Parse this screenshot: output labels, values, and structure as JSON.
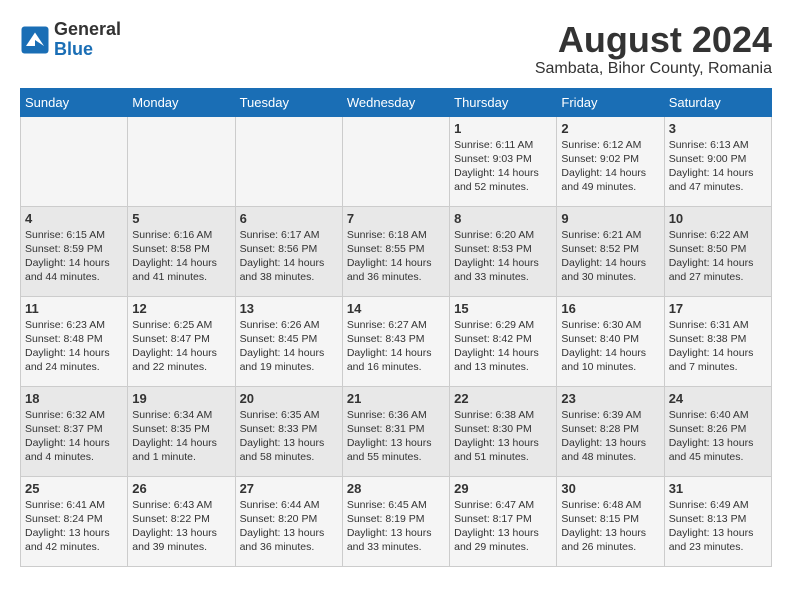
{
  "header": {
    "logo_general": "General",
    "logo_blue": "Blue",
    "month_year": "August 2024",
    "location": "Sambata, Bihor County, Romania"
  },
  "weekdays": [
    "Sunday",
    "Monday",
    "Tuesday",
    "Wednesday",
    "Thursday",
    "Friday",
    "Saturday"
  ],
  "weeks": [
    [
      {
        "day": "",
        "info": ""
      },
      {
        "day": "",
        "info": ""
      },
      {
        "day": "",
        "info": ""
      },
      {
        "day": "",
        "info": ""
      },
      {
        "day": "1",
        "info": "Sunrise: 6:11 AM\nSunset: 9:03 PM\nDaylight: 14 hours\nand 52 minutes."
      },
      {
        "day": "2",
        "info": "Sunrise: 6:12 AM\nSunset: 9:02 PM\nDaylight: 14 hours\nand 49 minutes."
      },
      {
        "day": "3",
        "info": "Sunrise: 6:13 AM\nSunset: 9:00 PM\nDaylight: 14 hours\nand 47 minutes."
      }
    ],
    [
      {
        "day": "4",
        "info": "Sunrise: 6:15 AM\nSunset: 8:59 PM\nDaylight: 14 hours\nand 44 minutes."
      },
      {
        "day": "5",
        "info": "Sunrise: 6:16 AM\nSunset: 8:58 PM\nDaylight: 14 hours\nand 41 minutes."
      },
      {
        "day": "6",
        "info": "Sunrise: 6:17 AM\nSunset: 8:56 PM\nDaylight: 14 hours\nand 38 minutes."
      },
      {
        "day": "7",
        "info": "Sunrise: 6:18 AM\nSunset: 8:55 PM\nDaylight: 14 hours\nand 36 minutes."
      },
      {
        "day": "8",
        "info": "Sunrise: 6:20 AM\nSunset: 8:53 PM\nDaylight: 14 hours\nand 33 minutes."
      },
      {
        "day": "9",
        "info": "Sunrise: 6:21 AM\nSunset: 8:52 PM\nDaylight: 14 hours\nand 30 minutes."
      },
      {
        "day": "10",
        "info": "Sunrise: 6:22 AM\nSunset: 8:50 PM\nDaylight: 14 hours\nand 27 minutes."
      }
    ],
    [
      {
        "day": "11",
        "info": "Sunrise: 6:23 AM\nSunset: 8:48 PM\nDaylight: 14 hours\nand 24 minutes."
      },
      {
        "day": "12",
        "info": "Sunrise: 6:25 AM\nSunset: 8:47 PM\nDaylight: 14 hours\nand 22 minutes."
      },
      {
        "day": "13",
        "info": "Sunrise: 6:26 AM\nSunset: 8:45 PM\nDaylight: 14 hours\nand 19 minutes."
      },
      {
        "day": "14",
        "info": "Sunrise: 6:27 AM\nSunset: 8:43 PM\nDaylight: 14 hours\nand 16 minutes."
      },
      {
        "day": "15",
        "info": "Sunrise: 6:29 AM\nSunset: 8:42 PM\nDaylight: 14 hours\nand 13 minutes."
      },
      {
        "day": "16",
        "info": "Sunrise: 6:30 AM\nSunset: 8:40 PM\nDaylight: 14 hours\nand 10 minutes."
      },
      {
        "day": "17",
        "info": "Sunrise: 6:31 AM\nSunset: 8:38 PM\nDaylight: 14 hours\nand 7 minutes."
      }
    ],
    [
      {
        "day": "18",
        "info": "Sunrise: 6:32 AM\nSunset: 8:37 PM\nDaylight: 14 hours\nand 4 minutes."
      },
      {
        "day": "19",
        "info": "Sunrise: 6:34 AM\nSunset: 8:35 PM\nDaylight: 14 hours\nand 1 minute."
      },
      {
        "day": "20",
        "info": "Sunrise: 6:35 AM\nSunset: 8:33 PM\nDaylight: 13 hours\nand 58 minutes."
      },
      {
        "day": "21",
        "info": "Sunrise: 6:36 AM\nSunset: 8:31 PM\nDaylight: 13 hours\nand 55 minutes."
      },
      {
        "day": "22",
        "info": "Sunrise: 6:38 AM\nSunset: 8:30 PM\nDaylight: 13 hours\nand 51 minutes."
      },
      {
        "day": "23",
        "info": "Sunrise: 6:39 AM\nSunset: 8:28 PM\nDaylight: 13 hours\nand 48 minutes."
      },
      {
        "day": "24",
        "info": "Sunrise: 6:40 AM\nSunset: 8:26 PM\nDaylight: 13 hours\nand 45 minutes."
      }
    ],
    [
      {
        "day": "25",
        "info": "Sunrise: 6:41 AM\nSunset: 8:24 PM\nDaylight: 13 hours\nand 42 minutes."
      },
      {
        "day": "26",
        "info": "Sunrise: 6:43 AM\nSunset: 8:22 PM\nDaylight: 13 hours\nand 39 minutes."
      },
      {
        "day": "27",
        "info": "Sunrise: 6:44 AM\nSunset: 8:20 PM\nDaylight: 13 hours\nand 36 minutes."
      },
      {
        "day": "28",
        "info": "Sunrise: 6:45 AM\nSunset: 8:19 PM\nDaylight: 13 hours\nand 33 minutes."
      },
      {
        "day": "29",
        "info": "Sunrise: 6:47 AM\nSunset: 8:17 PM\nDaylight: 13 hours\nand 29 minutes."
      },
      {
        "day": "30",
        "info": "Sunrise: 6:48 AM\nSunset: 8:15 PM\nDaylight: 13 hours\nand 26 minutes."
      },
      {
        "day": "31",
        "info": "Sunrise: 6:49 AM\nSunset: 8:13 PM\nDaylight: 13 hours\nand 23 minutes."
      }
    ]
  ]
}
